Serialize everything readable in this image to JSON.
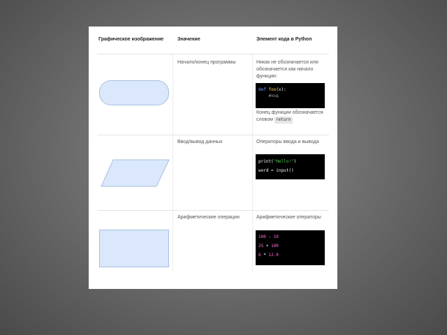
{
  "table": {
    "headers": {
      "shape": "Графическое изображение",
      "meaning": "Значение",
      "python": "Элемент кода в Python"
    },
    "rows": [
      {
        "shape": "terminator",
        "meaning": "Начало/конец программы",
        "python_text_1": "Никак не обозначается или обозначается как начало функции:",
        "code": {
          "line1_kw": "def",
          "line1_fn": "foo",
          "line1_rest": "(x):",
          "line2_comment": "#код"
        },
        "python_text_2": "Конец функции обозначается словом",
        "inline_code": "return"
      },
      {
        "shape": "parallelogram",
        "meaning": "Ввод/вывод данных",
        "python_text_1": "Операторы ввода и вывода",
        "code": {
          "line1_fn": "print",
          "line1_open": "(",
          "line1_str": "\"Hello!\"",
          "line1_close": ")",
          "line2": "word = input()"
        }
      },
      {
        "shape": "rectangle",
        "meaning": "Арифметические операции",
        "python_text_1": "Арифметические операторы",
        "code": {
          "line1": [
            "100",
            " - ",
            "10"
          ],
          "line2": [
            "25",
            " + ",
            "100"
          ],
          "line3": [
            "6",
            " * ",
            "12.0"
          ]
        }
      }
    ]
  },
  "colors": {
    "shape_fill": "#dbe8fb",
    "code_bg": "#000000",
    "keyword": "#6fa8ff",
    "function": "#ffd86b",
    "string": "#4cd84c",
    "number": "#ff6fd8"
  }
}
